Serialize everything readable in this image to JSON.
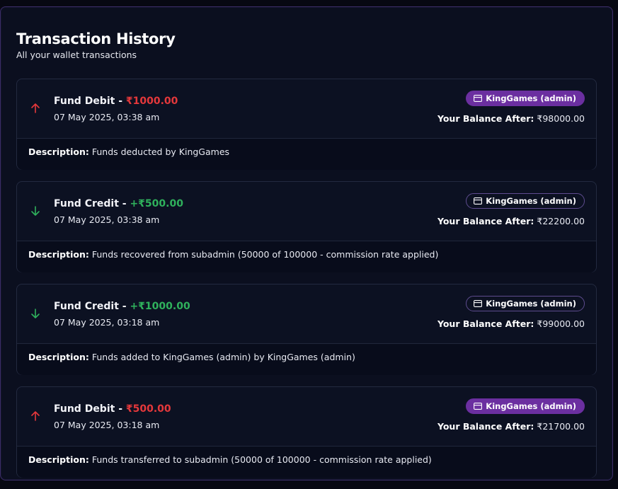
{
  "header": {
    "title": "Transaction History",
    "subtitle": "All your wallet transactions"
  },
  "labels": {
    "balance_after": "Your Balance After:",
    "description": "Description:"
  },
  "colors": {
    "debit": "#e5383b",
    "credit": "#2fb15c",
    "badge_filled": "#6b2fa0"
  },
  "transactions": [
    {
      "direction": "debit",
      "direction_icon": "arrow-up-icon",
      "type": "Fund Debit",
      "separator": " - ",
      "amount": "₹1000.00",
      "date": "07 May 2025, 03:38 am",
      "badge": "KingGames (admin)",
      "badge_icon": "wallet-card-icon",
      "badge_style": "filled",
      "balance_after": "₹98000.00",
      "description": "Funds deducted by KingGames"
    },
    {
      "direction": "credit",
      "direction_icon": "arrow-down-icon",
      "type": "Fund Credit",
      "separator": " - ",
      "amount": "+₹500.00",
      "date": "07 May 2025, 03:38 am",
      "badge": "KingGames (admin)",
      "badge_icon": "wallet-card-icon",
      "badge_style": "outline",
      "balance_after": "₹22200.00",
      "description": "Funds recovered from subadmin (50000 of 100000 - commission rate applied)"
    },
    {
      "direction": "credit",
      "direction_icon": "arrow-down-icon",
      "type": "Fund Credit",
      "separator": " - ",
      "amount": "+₹1000.00",
      "date": "07 May 2025, 03:18 am",
      "badge": "KingGames (admin)",
      "badge_icon": "wallet-card-icon",
      "badge_style": "outline",
      "balance_after": "₹99000.00",
      "description": "Funds added to KingGames (admin) by KingGames (admin)"
    },
    {
      "direction": "debit",
      "direction_icon": "arrow-up-icon",
      "type": "Fund Debit",
      "separator": " - ",
      "amount": "₹500.00",
      "date": "07 May 2025, 03:18 am",
      "badge": "KingGames (admin)",
      "badge_icon": "wallet-card-icon",
      "badge_style": "filled",
      "balance_after": "₹21700.00",
      "description": "Funds transferred to subadmin (50000 of 100000 - commission rate applied)"
    }
  ]
}
